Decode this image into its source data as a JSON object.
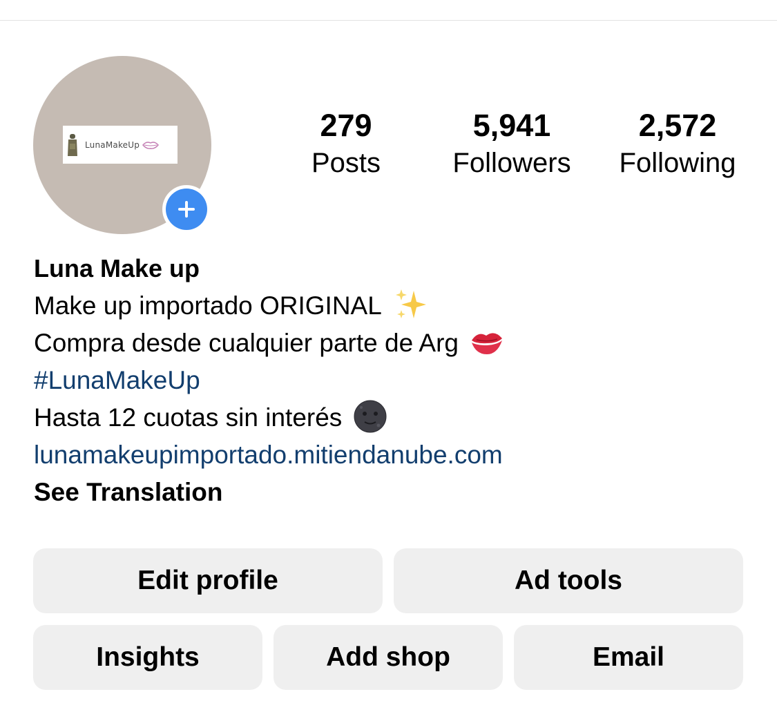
{
  "profile": {
    "avatar_logo_text": "LunaMakeUp",
    "add_story_icon": "plus-icon",
    "accent_color": "#3e8cf1"
  },
  "stats": {
    "posts": {
      "count": "279",
      "label": "Posts"
    },
    "followers": {
      "count": "5,941",
      "label": "Followers"
    },
    "following": {
      "count": "2,572",
      "label": "Following"
    }
  },
  "bio": {
    "name": "Luna Make up",
    "line1": "Make up importado ORIGINAL",
    "line1_icon": "sparkles-icon",
    "line2": "Compra desde cualquier parte de Arg",
    "line2_icon": "kiss-mark-icon",
    "hashtag": "#LunaMakeUp",
    "line4": "Hasta 12 cuotas sin interés",
    "line4_icon": "new-moon-face-icon",
    "link": "lunamakeupimportado.mitiendanube.com",
    "see_translation": "See Translation",
    "link_color": "#123e6e"
  },
  "buttons": {
    "edit_profile": "Edit profile",
    "ad_tools": "Ad tools",
    "insights": "Insights",
    "add_shop": "Add shop",
    "email": "Email",
    "background": "#efefef"
  }
}
